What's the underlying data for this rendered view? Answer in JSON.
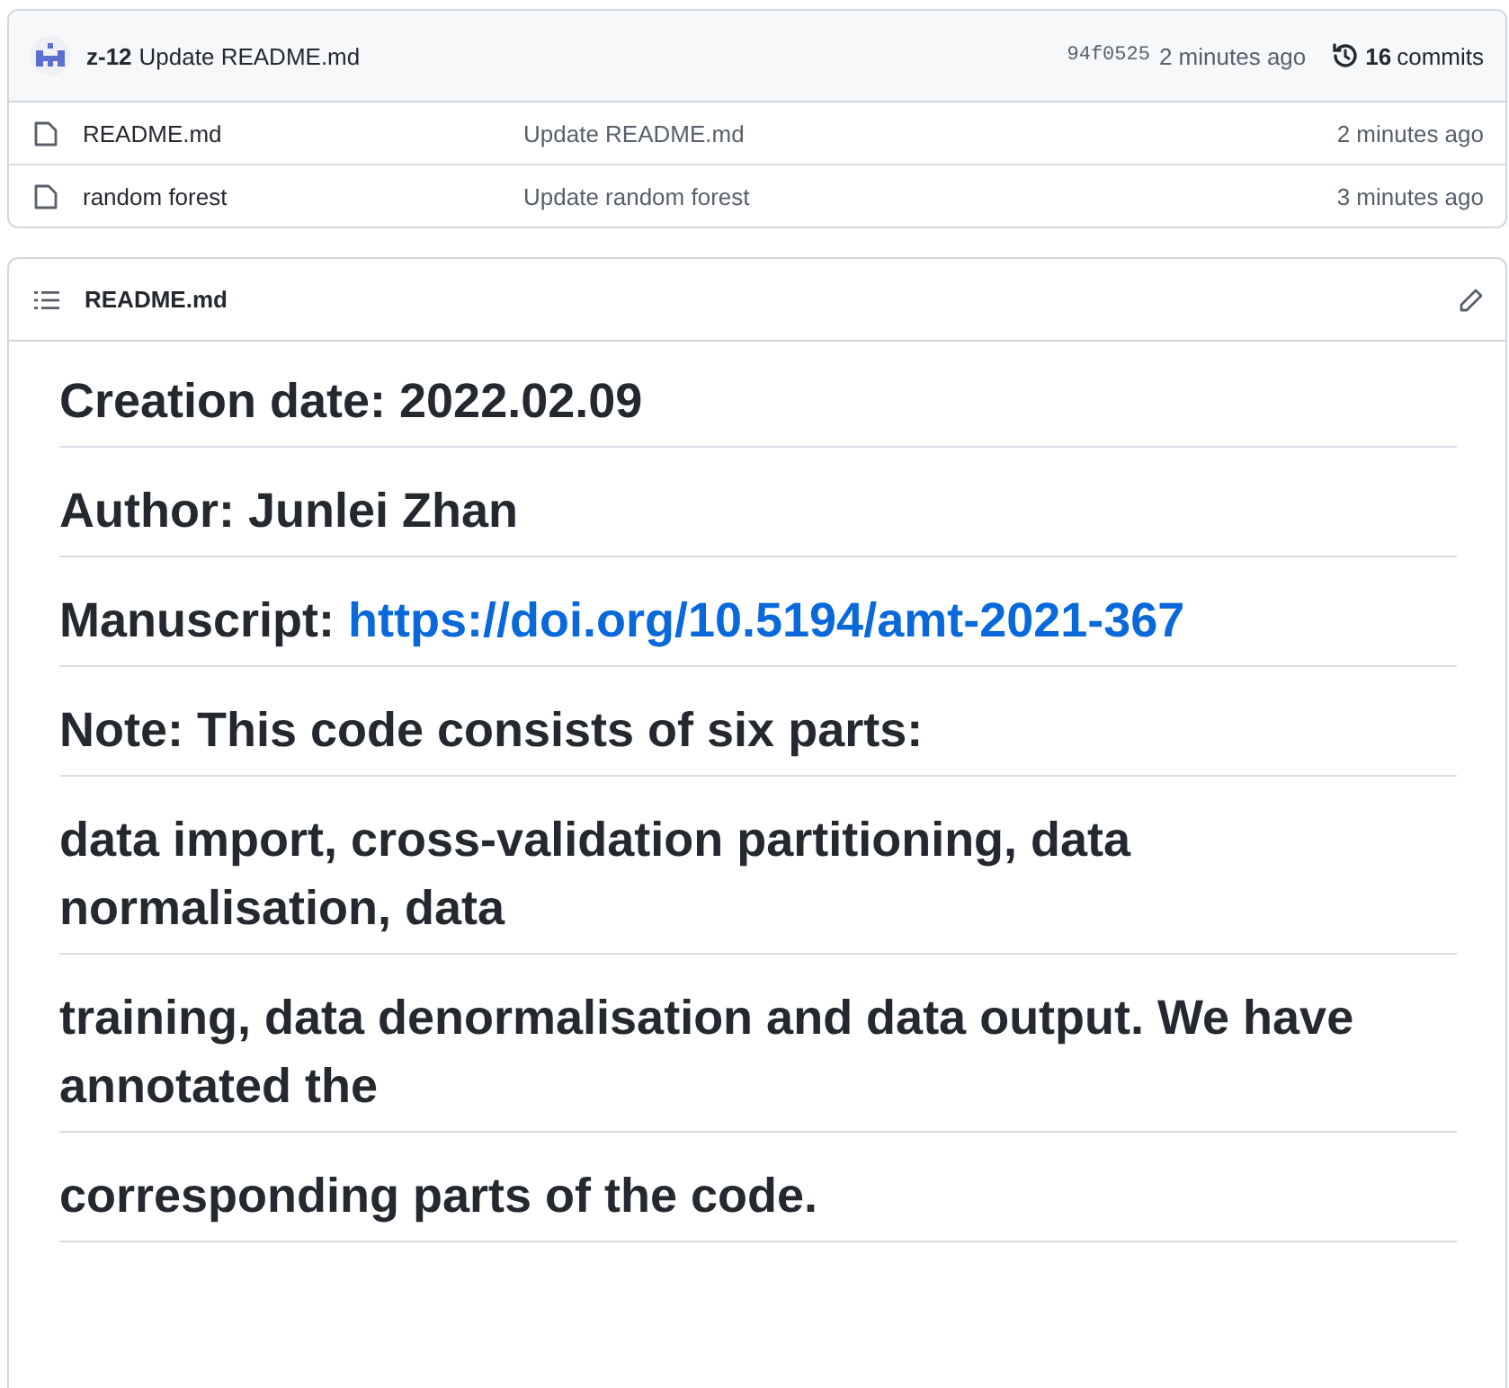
{
  "latest_commit": {
    "author": "z-12",
    "message": "Update README.md",
    "sha": "94f0525",
    "time": "2 minutes ago",
    "commit_count": "16",
    "commit_label": "commits"
  },
  "files": [
    {
      "name": "README.md",
      "message": "Update README.md",
      "time": "2 minutes ago"
    },
    {
      "name": "random forest",
      "message": "Update random forest",
      "time": "3 minutes ago"
    }
  ],
  "readme": {
    "title": "README.md",
    "headings": [
      {
        "text": "Creation date: 2022.02.09"
      },
      {
        "text": "Author: Junlei Zhan"
      },
      {
        "text": "Manuscript: ",
        "link": "https://doi.org/10.5194/amt-2021-367"
      },
      {
        "text": "Note: This code consists of six parts:"
      },
      {
        "text": "data import, cross-validation partitioning, data normalisation, data"
      },
      {
        "text": "training, data denormalisation and data output. We have annotated the"
      },
      {
        "text": "corresponding parts of the code."
      }
    ]
  }
}
